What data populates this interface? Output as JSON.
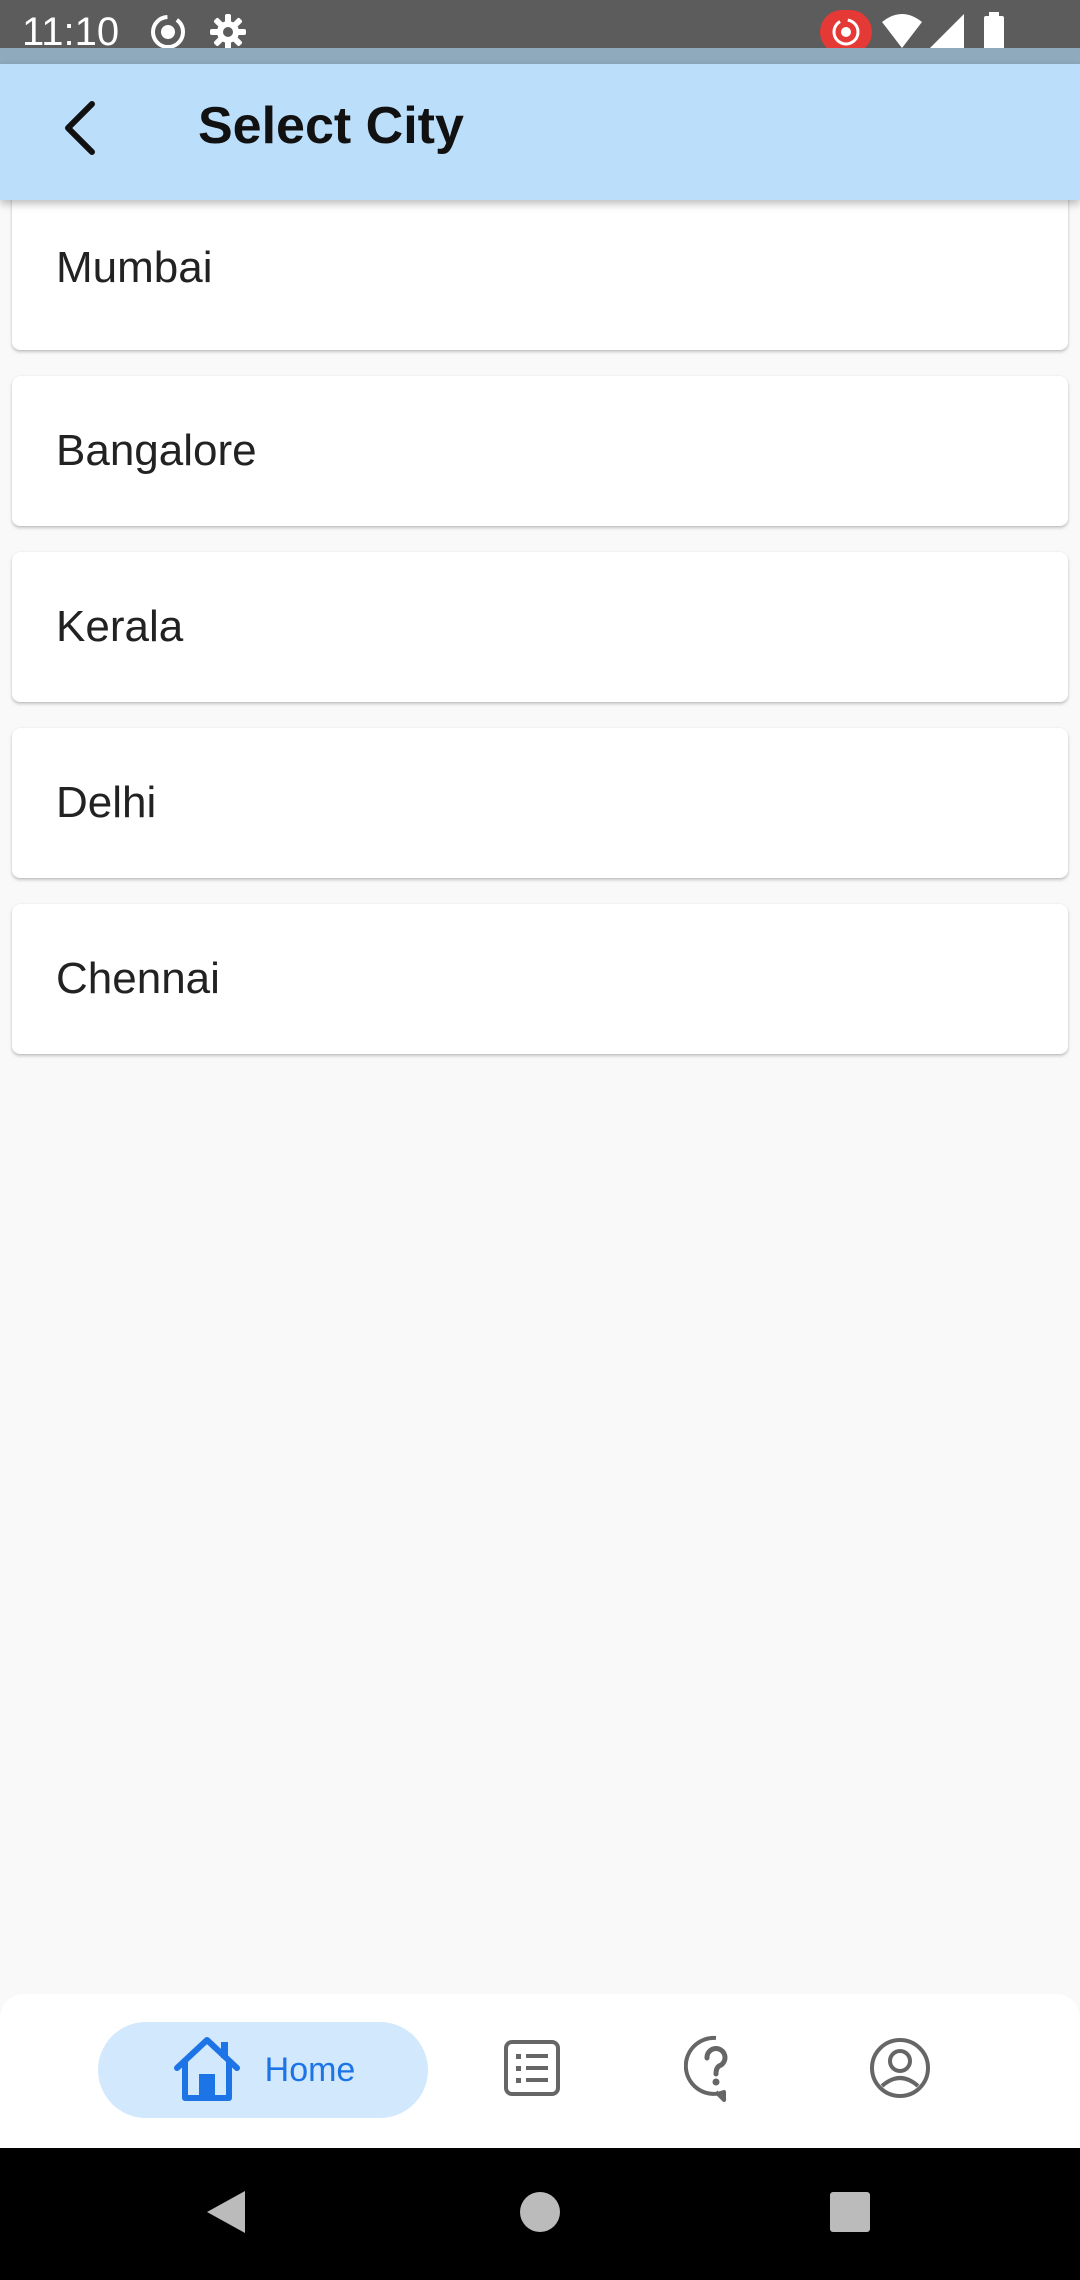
{
  "status_bar": {
    "time": "11:10",
    "icons": [
      "screen-record-icon",
      "settings-icon",
      "recording-indicator-icon",
      "wifi-icon",
      "signal-icon",
      "battery-icon"
    ]
  },
  "app_bar": {
    "title": "Select City",
    "back_icon": "back-arrow-icon",
    "background_color": "#bbdefa"
  },
  "cities": [
    {
      "name": "Mumbai"
    },
    {
      "name": "Bangalore"
    },
    {
      "name": "Kerala"
    },
    {
      "name": "Delhi"
    },
    {
      "name": "Chennai"
    }
  ],
  "bottom_nav": {
    "items": [
      {
        "label": "Home",
        "icon": "home-icon",
        "active": true
      },
      {
        "label": "",
        "icon": "list-icon",
        "active": false
      },
      {
        "label": "",
        "icon": "help-icon",
        "active": false
      },
      {
        "label": "",
        "icon": "profile-icon",
        "active": false
      }
    ],
    "active_color": "#1c74e6",
    "active_background": "#d2e8fd",
    "inactive_color": "#666666"
  },
  "system_nav": {
    "buttons": [
      "back-triangle-icon",
      "home-circle-icon",
      "recents-square-icon"
    ]
  }
}
